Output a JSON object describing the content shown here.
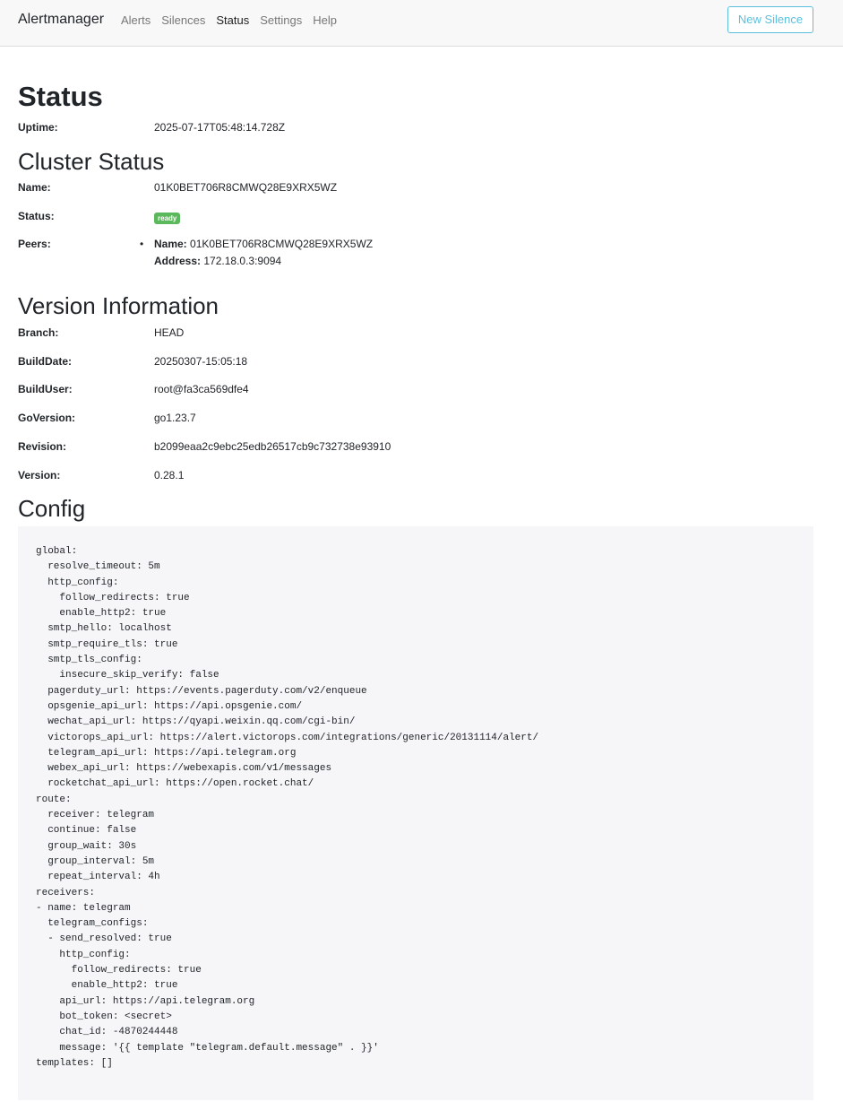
{
  "navbar": {
    "brand": "Alertmanager",
    "links": [
      "Alerts",
      "Silences",
      "Status",
      "Settings",
      "Help"
    ],
    "active": "Status",
    "new_silence_label": "New Silence"
  },
  "status": {
    "title": "Status",
    "uptime_label": "Uptime:",
    "uptime_value": "2025-07-17T05:48:14.728Z"
  },
  "cluster": {
    "title": "Cluster Status",
    "name_label": "Name:",
    "name_value": "01K0BET706R8CMWQ28E9XRX5WZ",
    "status_label": "Status:",
    "status_value": "ready",
    "peers_label": "Peers:",
    "peers": [
      {
        "name_label": "Name:",
        "name": "01K0BET706R8CMWQ28E9XRX5WZ",
        "address_label": "Address:",
        "address": "172.18.0.3:9094"
      }
    ]
  },
  "version": {
    "title": "Version Information",
    "rows": [
      {
        "label": "Branch:",
        "value": "HEAD"
      },
      {
        "label": "BuildDate:",
        "value": "20250307-15:05:18"
      },
      {
        "label": "BuildUser:",
        "value": "root@fa3ca569dfe4"
      },
      {
        "label": "GoVersion:",
        "value": "go1.23.7"
      },
      {
        "label": "Revision:",
        "value": "b2099eaa2c9ebc25edb26517cb9c732738e93910"
      },
      {
        "label": "Version:",
        "value": "0.28.1"
      }
    ]
  },
  "config": {
    "title": "Config",
    "text": "global:\n  resolve_timeout: 5m\n  http_config:\n    follow_redirects: true\n    enable_http2: true\n  smtp_hello: localhost\n  smtp_require_tls: true\n  smtp_tls_config:\n    insecure_skip_verify: false\n  pagerduty_url: https://events.pagerduty.com/v2/enqueue\n  opsgenie_api_url: https://api.opsgenie.com/\n  wechat_api_url: https://qyapi.weixin.qq.com/cgi-bin/\n  victorops_api_url: https://alert.victorops.com/integrations/generic/20131114/alert/\n  telegram_api_url: https://api.telegram.org\n  webex_api_url: https://webexapis.com/v1/messages\n  rocketchat_api_url: https://open.rocket.chat/\nroute:\n  receiver: telegram\n  continue: false\n  group_wait: 30s\n  group_interval: 5m\n  repeat_interval: 4h\nreceivers:\n- name: telegram\n  telegram_configs:\n  - send_resolved: true\n    http_config:\n      follow_redirects: true\n      enable_http2: true\n    api_url: https://api.telegram.org\n    bot_token: <secret>\n    chat_id: -4870244448\n    message: '{{ template \"telegram.default.message\" . }}'\ntemplates: []"
  },
  "colors": {
    "accent": "#5bc0de",
    "ready_badge": "#5cb85c",
    "navbar_bg": "#f8f8f9",
    "config_bg": "#f6f6f8"
  }
}
